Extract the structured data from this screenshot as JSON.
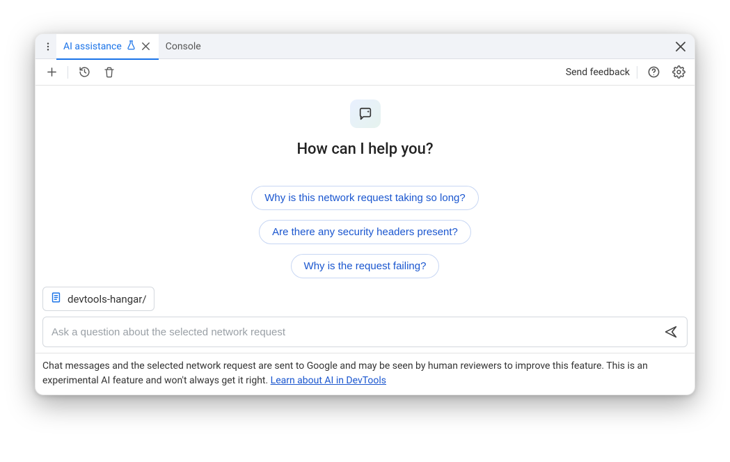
{
  "tabs": {
    "active": {
      "label": "AI assistance"
    },
    "secondary": {
      "label": "Console"
    }
  },
  "toolbar": {
    "feedback_label": "Send feedback"
  },
  "main": {
    "greeting": "How can I help you?",
    "suggestions": [
      "Why is this network request taking so long?",
      "Are there any security headers present?",
      "Why is the request failing?"
    ]
  },
  "context": {
    "label": "devtools-hangar/"
  },
  "input": {
    "placeholder": "Ask a question about the selected network request"
  },
  "footer": {
    "disclaimer": "Chat messages and the selected network request are sent to Google and may be seen by human reviewers to improve this feature. This is an experimental AI feature and won't always get it right. ",
    "link_text": "Learn about AI in DevTools"
  }
}
